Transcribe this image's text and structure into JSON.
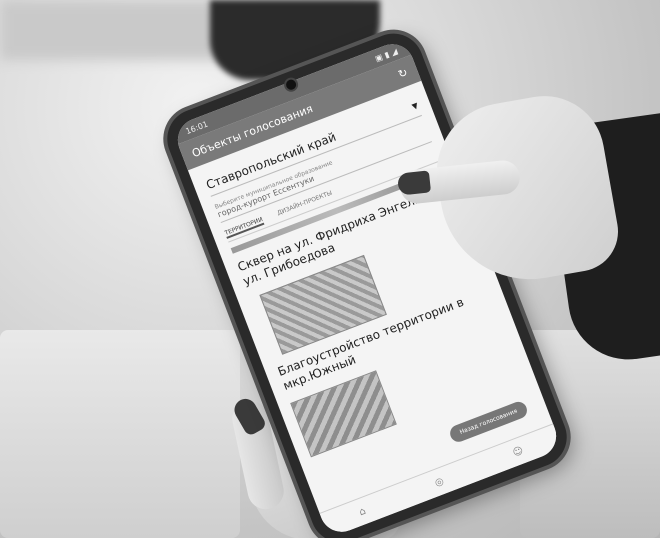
{
  "phone": {
    "status_time": "16:01",
    "status_icons": "▣ ▮ ◢",
    "app_title": "Объекты голосования",
    "refresh_icon": "refresh-icon",
    "region": "Ставропольский край",
    "field_label": "Выберите муниципальное образование",
    "field_value": "город-курорт Ессентуки",
    "tabs": [
      "ТЕРРИТОРИИ",
      "ДИЗАЙН-ПРОЕКТЫ"
    ],
    "objects": [
      {
        "title": "Сквер на ул. Фридриха Энгельса/ул. Грибоедова"
      },
      {
        "title": "Благоустройство территории в мкр.Южный"
      }
    ],
    "vote_button": "Назад голосования",
    "nav_icons": [
      "home-icon",
      "map-icon",
      "profile-icon"
    ]
  }
}
